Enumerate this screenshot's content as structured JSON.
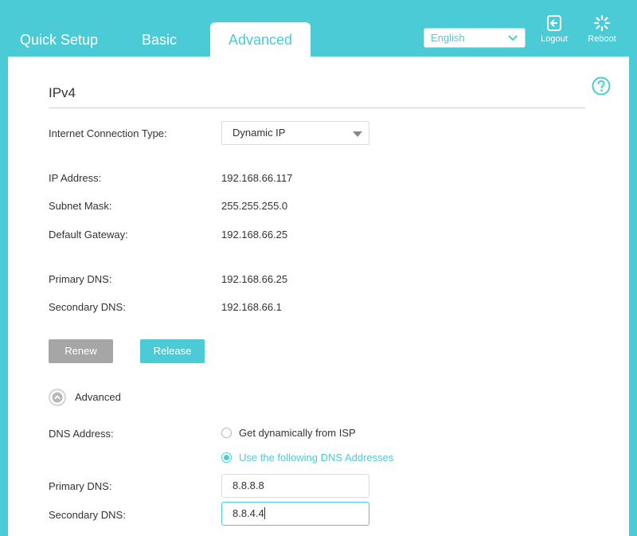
{
  "nav": {
    "tabs": [
      "Quick Setup",
      "Basic",
      "Advanced"
    ],
    "language": "English",
    "logout_label": "Logout",
    "reboot_label": "Reboot"
  },
  "ipv4": {
    "title": "IPv4",
    "connection_type_label": "Internet Connection Type:",
    "connection_type_value": "Dynamic IP",
    "ip_address_label": "IP Address:",
    "ip_address_value": "192.168.66.117",
    "subnet_mask_label": "Subnet Mask:",
    "subnet_mask_value": "255.255.255.0",
    "gateway_label": "Default Gateway:",
    "gateway_value": "192.168.66.25",
    "primary_dns_label": "Primary DNS:",
    "primary_dns_value": "192.168.66.25",
    "secondary_dns_label": "Secondary DNS:",
    "secondary_dns_value": "192.168.66.1",
    "renew_label": "Renew",
    "release_label": "Release"
  },
  "advanced": {
    "toggle_label": "Advanced",
    "dns_address_label": "DNS Address:",
    "option_dynamic": "Get dynamically from ISP",
    "option_static": "Use the following DNS Addresses",
    "primary_dns_label": "Primary DNS:",
    "primary_dns_value": "8.8.8.8",
    "secondary_dns_label": "Secondary DNS:",
    "secondary_dns_value": "8.8.4.4"
  },
  "colors": {
    "accent": "#4acbd6",
    "renew_button": "#a6a6a6"
  },
  "icons": [
    "chevron-down-icon",
    "logout-icon",
    "reboot-icon",
    "help-icon",
    "chevron-up-circle-icon"
  ]
}
